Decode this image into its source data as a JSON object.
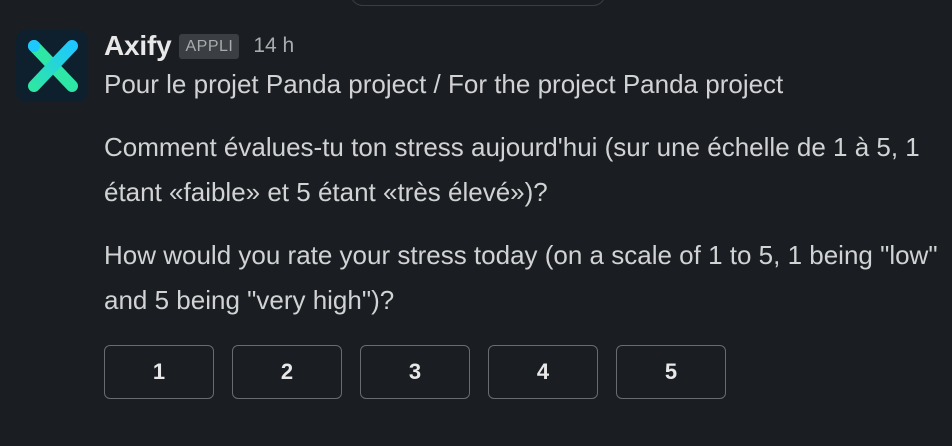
{
  "message": {
    "sender": "Axify",
    "badge": "APPLI",
    "time": "14 h",
    "line1": "Pour le projet Panda project / For the project Panda project",
    "french_question": "Comment évalues-tu ton stress aujourd'hui (sur une échelle de 1 à 5, 1 étant «faible» et 5 étant «très élevé»)?",
    "english_question": "How would you rate your stress today (on a scale of 1 to 5, 1 being \"low\" and 5 being \"very high\")?"
  },
  "rating_buttons": [
    "1",
    "2",
    "3",
    "4",
    "5"
  ],
  "colors": {
    "background": "#1a1d21",
    "text": "#d1d2d3",
    "logo_green": "#2ee6a6",
    "logo_blue": "#1ec8ff"
  }
}
